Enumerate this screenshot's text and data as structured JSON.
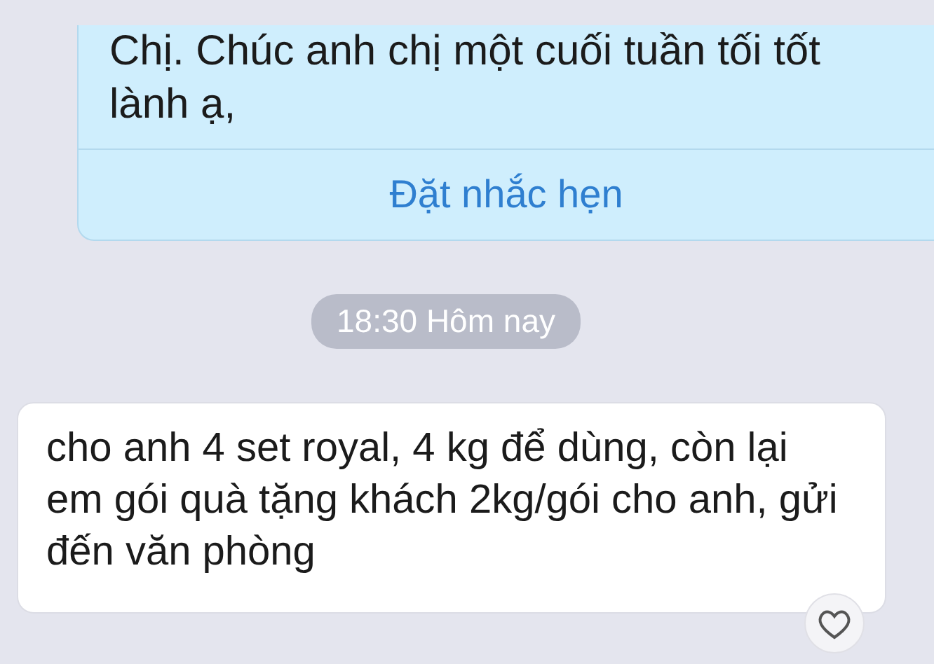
{
  "messages": [
    {
      "kind": "incoming-official",
      "text": "Chị. Chúc anh chị một cuối tuần tối tốt lành ạ,",
      "action": "Đặt nhắc hẹn"
    },
    {
      "kind": "timestamp",
      "text": "18:30 Hôm nay"
    },
    {
      "kind": "outgoing",
      "text": "cho anh 4 set royal, 4 kg để dùng, còn lại em gói quà tặng khách 2kg/gói cho anh, gửi đến văn phòng",
      "reacted": false
    }
  ]
}
